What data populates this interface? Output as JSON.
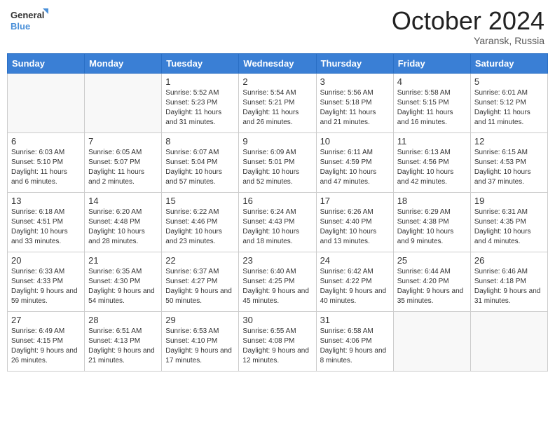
{
  "logo": {
    "line1": "General",
    "line2": "Blue"
  },
  "title": "October 2024",
  "location": "Yaransk, Russia",
  "days_header": [
    "Sunday",
    "Monday",
    "Tuesday",
    "Wednesday",
    "Thursday",
    "Friday",
    "Saturday"
  ],
  "weeks": [
    [
      {
        "num": "",
        "info": ""
      },
      {
        "num": "",
        "info": ""
      },
      {
        "num": "1",
        "info": "Sunrise: 5:52 AM\nSunset: 5:23 PM\nDaylight: 11 hours and 31 minutes."
      },
      {
        "num": "2",
        "info": "Sunrise: 5:54 AM\nSunset: 5:21 PM\nDaylight: 11 hours and 26 minutes."
      },
      {
        "num": "3",
        "info": "Sunrise: 5:56 AM\nSunset: 5:18 PM\nDaylight: 11 hours and 21 minutes."
      },
      {
        "num": "4",
        "info": "Sunrise: 5:58 AM\nSunset: 5:15 PM\nDaylight: 11 hours and 16 minutes."
      },
      {
        "num": "5",
        "info": "Sunrise: 6:01 AM\nSunset: 5:12 PM\nDaylight: 11 hours and 11 minutes."
      }
    ],
    [
      {
        "num": "6",
        "info": "Sunrise: 6:03 AM\nSunset: 5:10 PM\nDaylight: 11 hours and 6 minutes."
      },
      {
        "num": "7",
        "info": "Sunrise: 6:05 AM\nSunset: 5:07 PM\nDaylight: 11 hours and 2 minutes."
      },
      {
        "num": "8",
        "info": "Sunrise: 6:07 AM\nSunset: 5:04 PM\nDaylight: 10 hours and 57 minutes."
      },
      {
        "num": "9",
        "info": "Sunrise: 6:09 AM\nSunset: 5:01 PM\nDaylight: 10 hours and 52 minutes."
      },
      {
        "num": "10",
        "info": "Sunrise: 6:11 AM\nSunset: 4:59 PM\nDaylight: 10 hours and 47 minutes."
      },
      {
        "num": "11",
        "info": "Sunrise: 6:13 AM\nSunset: 4:56 PM\nDaylight: 10 hours and 42 minutes."
      },
      {
        "num": "12",
        "info": "Sunrise: 6:15 AM\nSunset: 4:53 PM\nDaylight: 10 hours and 37 minutes."
      }
    ],
    [
      {
        "num": "13",
        "info": "Sunrise: 6:18 AM\nSunset: 4:51 PM\nDaylight: 10 hours and 33 minutes."
      },
      {
        "num": "14",
        "info": "Sunrise: 6:20 AM\nSunset: 4:48 PM\nDaylight: 10 hours and 28 minutes."
      },
      {
        "num": "15",
        "info": "Sunrise: 6:22 AM\nSunset: 4:46 PM\nDaylight: 10 hours and 23 minutes."
      },
      {
        "num": "16",
        "info": "Sunrise: 6:24 AM\nSunset: 4:43 PM\nDaylight: 10 hours and 18 minutes."
      },
      {
        "num": "17",
        "info": "Sunrise: 6:26 AM\nSunset: 4:40 PM\nDaylight: 10 hours and 13 minutes."
      },
      {
        "num": "18",
        "info": "Sunrise: 6:29 AM\nSunset: 4:38 PM\nDaylight: 10 hours and 9 minutes."
      },
      {
        "num": "19",
        "info": "Sunrise: 6:31 AM\nSunset: 4:35 PM\nDaylight: 10 hours and 4 minutes."
      }
    ],
    [
      {
        "num": "20",
        "info": "Sunrise: 6:33 AM\nSunset: 4:33 PM\nDaylight: 9 hours and 59 minutes."
      },
      {
        "num": "21",
        "info": "Sunrise: 6:35 AM\nSunset: 4:30 PM\nDaylight: 9 hours and 54 minutes."
      },
      {
        "num": "22",
        "info": "Sunrise: 6:37 AM\nSunset: 4:27 PM\nDaylight: 9 hours and 50 minutes."
      },
      {
        "num": "23",
        "info": "Sunrise: 6:40 AM\nSunset: 4:25 PM\nDaylight: 9 hours and 45 minutes."
      },
      {
        "num": "24",
        "info": "Sunrise: 6:42 AM\nSunset: 4:22 PM\nDaylight: 9 hours and 40 minutes."
      },
      {
        "num": "25",
        "info": "Sunrise: 6:44 AM\nSunset: 4:20 PM\nDaylight: 9 hours and 35 minutes."
      },
      {
        "num": "26",
        "info": "Sunrise: 6:46 AM\nSunset: 4:18 PM\nDaylight: 9 hours and 31 minutes."
      }
    ],
    [
      {
        "num": "27",
        "info": "Sunrise: 6:49 AM\nSunset: 4:15 PM\nDaylight: 9 hours and 26 minutes."
      },
      {
        "num": "28",
        "info": "Sunrise: 6:51 AM\nSunset: 4:13 PM\nDaylight: 9 hours and 21 minutes."
      },
      {
        "num": "29",
        "info": "Sunrise: 6:53 AM\nSunset: 4:10 PM\nDaylight: 9 hours and 17 minutes."
      },
      {
        "num": "30",
        "info": "Sunrise: 6:55 AM\nSunset: 4:08 PM\nDaylight: 9 hours and 12 minutes."
      },
      {
        "num": "31",
        "info": "Sunrise: 6:58 AM\nSunset: 4:06 PM\nDaylight: 9 hours and 8 minutes."
      },
      {
        "num": "",
        "info": ""
      },
      {
        "num": "",
        "info": ""
      }
    ]
  ]
}
